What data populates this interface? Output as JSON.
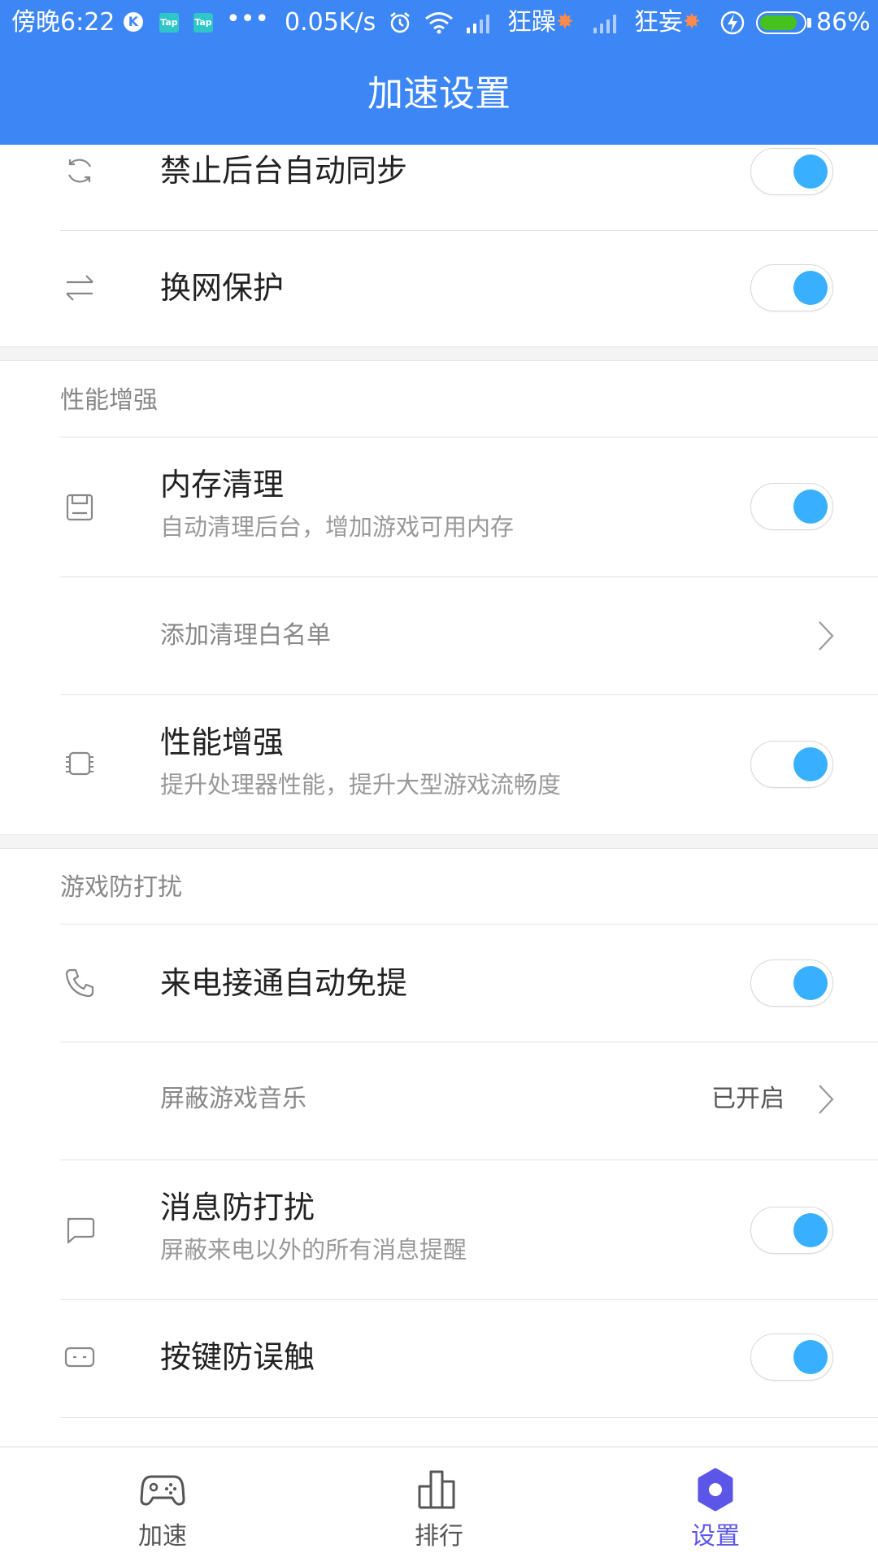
{
  "status_bar": {
    "time": "傍晚6:22",
    "k_badge": "K",
    "tap_badge": "Tap",
    "more": "•••",
    "speed": "0.05K/s",
    "carrier1": "狂躁",
    "carrier2": "狂妄",
    "battery_percent": "86%",
    "battery_level": 0.86
  },
  "header": {
    "title": "加速设置"
  },
  "rows_top": [
    {
      "label": "禁止后台自动同步",
      "icon": "sync-icon",
      "toggle_on": true
    },
    {
      "label": "换网保护",
      "icon": "swap-arrows-icon",
      "toggle_on": true
    }
  ],
  "section_performance": {
    "title": "性能增强",
    "memory": {
      "label": "内存清理",
      "description": "自动清理后台，增加游戏可用内存",
      "icon": "memory-card-icon",
      "toggle_on": true
    },
    "whitelist": {
      "label": "添加清理白名单"
    },
    "boost": {
      "label": "性能增强",
      "description": "提升处理器性能，提升大型游戏流畅度",
      "icon": "chip-icon",
      "toggle_on": true
    }
  },
  "section_dnd": {
    "title": "游戏防打扰",
    "call": {
      "label": "来电接通自动免提",
      "icon": "phone-icon",
      "toggle_on": true
    },
    "music": {
      "label": "屏蔽游戏音乐",
      "value": "已开启"
    },
    "message": {
      "label": "消息防打扰",
      "description": "屏蔽来电以外的所有消息提醒",
      "icon": "chat-bubble-icon",
      "toggle_on": true
    },
    "keys": {
      "label": "按键防误触",
      "icon": "keypad-icon",
      "toggle_on": true
    }
  },
  "bottom_nav": [
    {
      "label": "加速",
      "icon": "gamepad-icon",
      "active": false
    },
    {
      "label": "排行",
      "icon": "bar-chart-icon",
      "active": false
    },
    {
      "label": "设置",
      "icon": "gear-icon",
      "active": true
    }
  ],
  "colors": {
    "header_bg": "#3d86f5",
    "toggle_on": "#39b0ff",
    "nav_active": "#5b56e8",
    "nav_inactive": "#555555",
    "battery_fill": "#46c21e"
  }
}
